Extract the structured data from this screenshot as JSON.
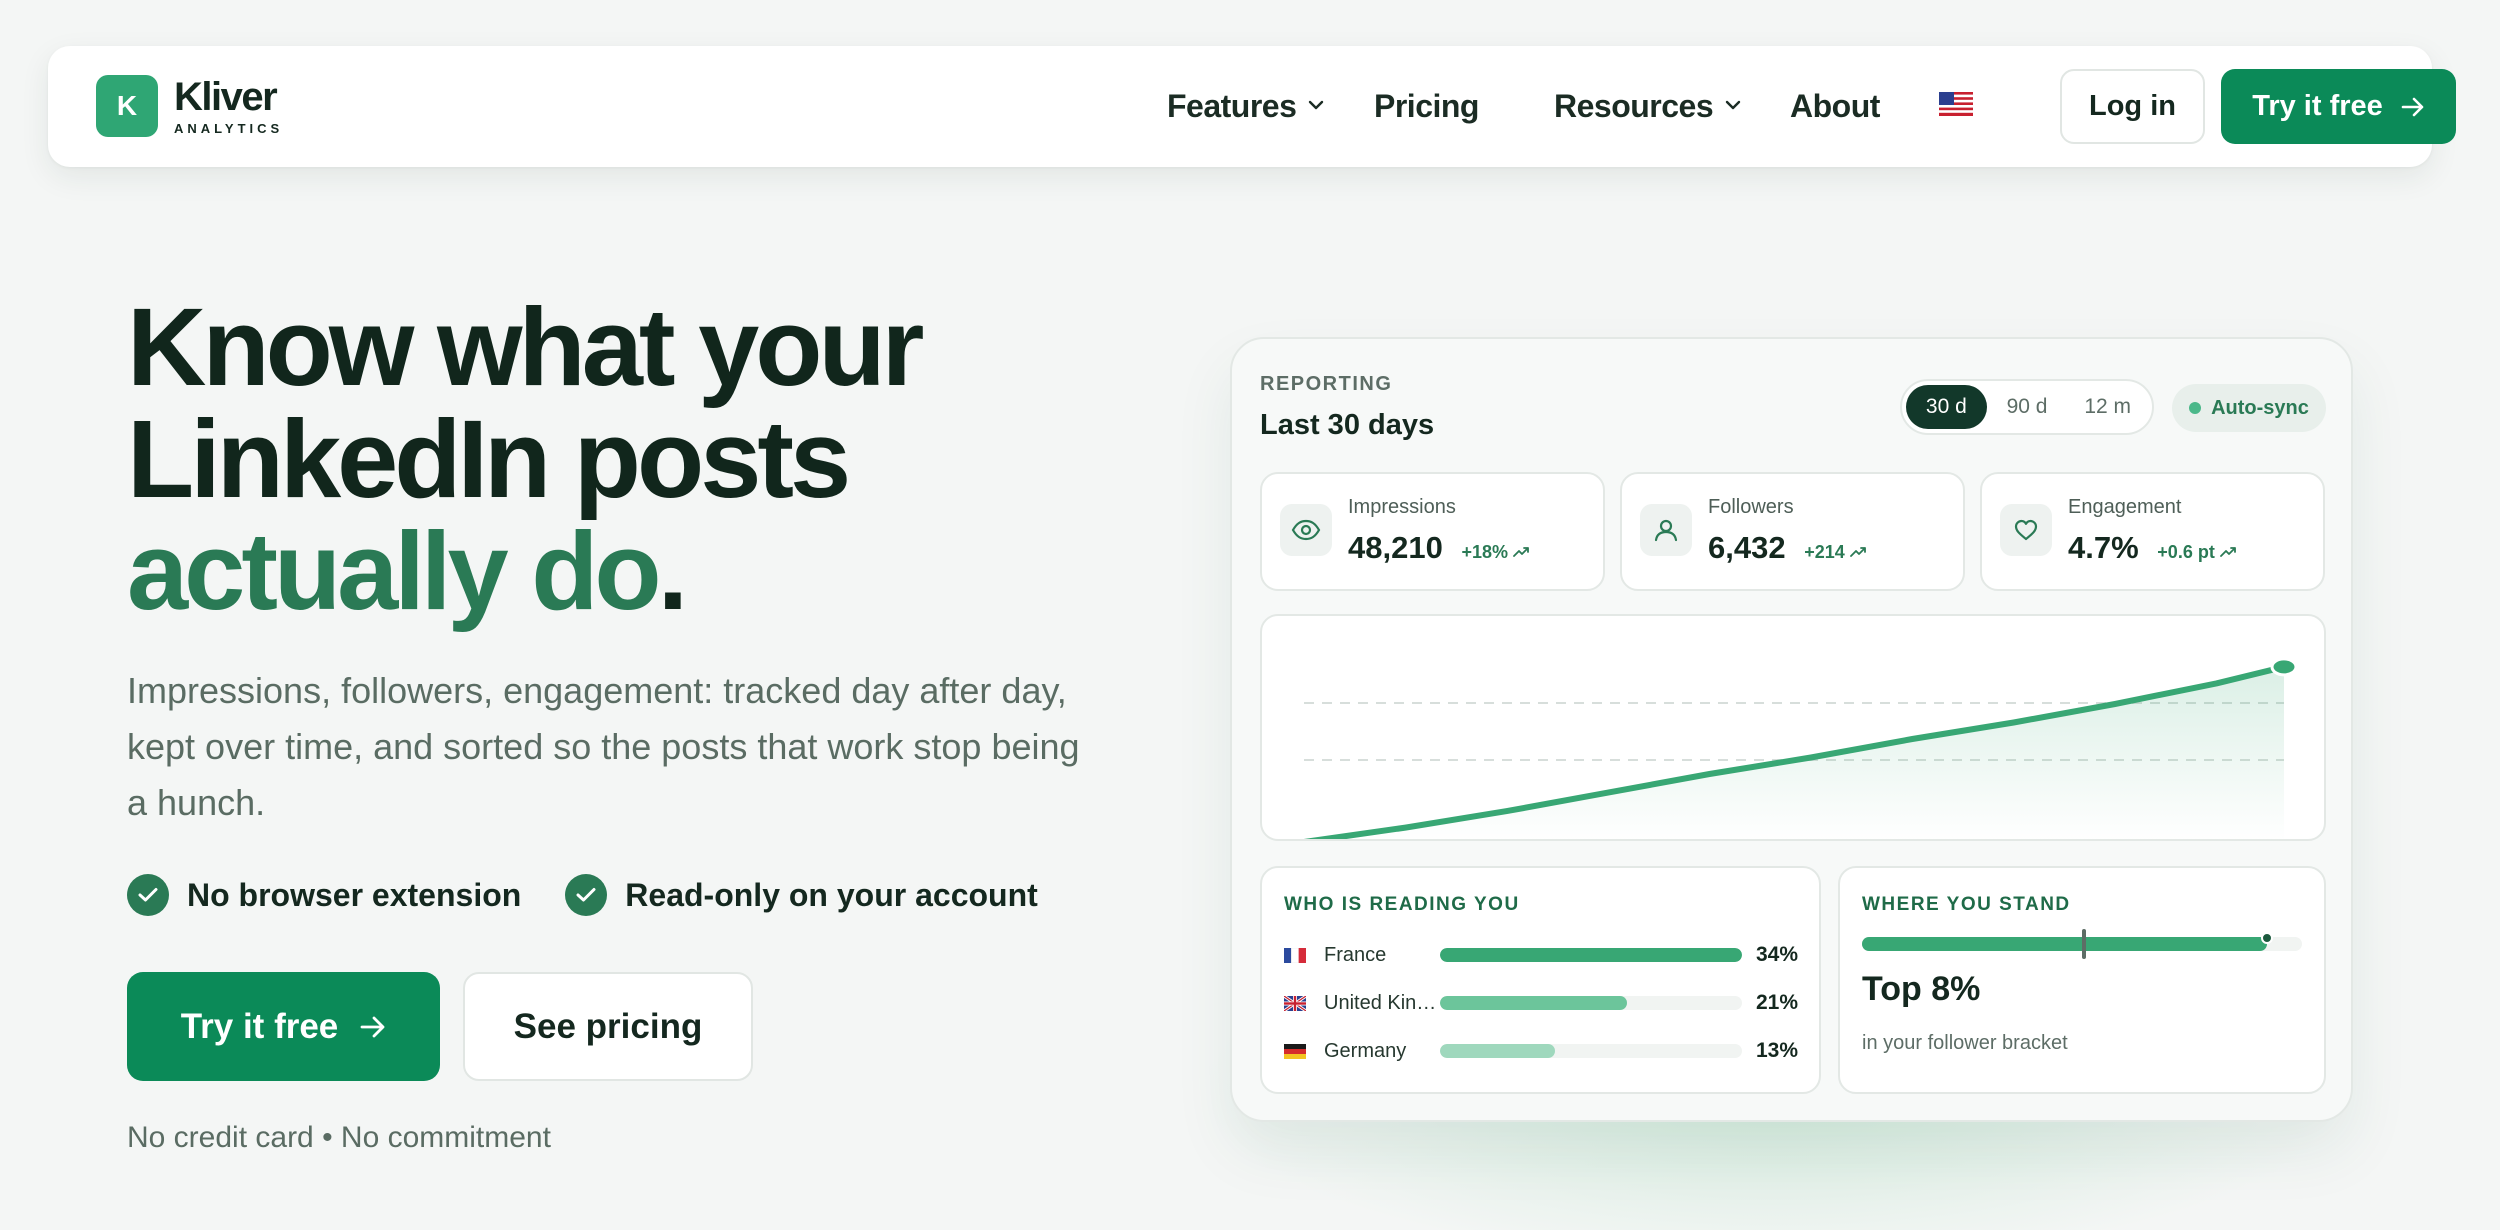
{
  "brand": {
    "mark": "K",
    "name": "Kliver",
    "tagline": "ANALYTICS",
    "accent_color": "#0b8a58"
  },
  "nav": {
    "items": [
      {
        "label": "Features",
        "has_dropdown": true
      },
      {
        "label": "Pricing",
        "has_dropdown": false
      },
      {
        "label": "Resources",
        "has_dropdown": true
      },
      {
        "label": "About",
        "has_dropdown": false
      }
    ],
    "language_icon": "us-flag-icon",
    "login_label": "Log in",
    "cta_label": "Try it free"
  },
  "hero": {
    "title_line1": "Know what your",
    "title_line2": "LinkedIn posts",
    "title_accent": "actually do",
    "title_period": ".",
    "description": "Impressions, followers, engagement: tracked day after day, kept over time, and sorted so the posts that work stop being a hunch.",
    "checks": [
      "No browser extension",
      "Read-only on your account"
    ],
    "primary_cta": "Try it free",
    "secondary_cta": "See pricing",
    "fine_print": "No credit card • No commitment"
  },
  "dashboard": {
    "section_label": "REPORTING",
    "period_title": "Last 30 days",
    "ranges": [
      {
        "label": "30 d",
        "active": true
      },
      {
        "label": "90 d",
        "active": false
      },
      {
        "label": "12 m",
        "active": false
      }
    ],
    "sync_label": "Auto-sync",
    "stats": [
      {
        "label": "Impressions",
        "value": "48,210",
        "delta": "+18%",
        "icon": "eye-icon"
      },
      {
        "label": "Followers",
        "value": "6,432",
        "delta": "+214",
        "icon": "user-icon"
      },
      {
        "label": "Engagement",
        "value": "4.7%",
        "delta": "+0.6 pt",
        "icon": "heart-icon"
      }
    ],
    "audience": {
      "heading": "WHO IS READING YOU",
      "countries": [
        {
          "name": "France",
          "pct_label": "34%",
          "fill": 1.0,
          "color": "#38a774"
        },
        {
          "name": "United Kingdom",
          "pct_label": "21%",
          "fill": 0.62,
          "color": "#6cc59b"
        },
        {
          "name": "Germany",
          "pct_label": "13%",
          "fill": 0.38,
          "color": "#9fd8bd"
        }
      ]
    },
    "standing": {
      "heading": "WHERE YOU STAND",
      "value": "Top 8%",
      "subtitle": "in your follower bracket",
      "fill": 0.92
    }
  },
  "chart_data": {
    "type": "area",
    "x": [
      1,
      4,
      7,
      10,
      13,
      16,
      19,
      22,
      25,
      28,
      30
    ],
    "values": [
      0,
      7,
      15,
      24,
      33,
      41,
      50,
      58,
      67,
      77,
      85
    ],
    "ylim": [
      0,
      100
    ],
    "title": "",
    "xlabel": "",
    "ylabel": "",
    "grid": true,
    "legend": "none",
    "color": "#38a774"
  }
}
